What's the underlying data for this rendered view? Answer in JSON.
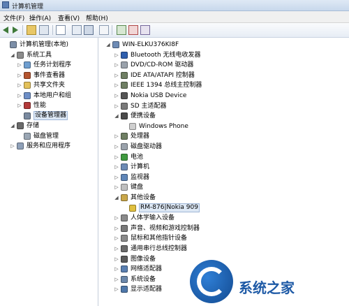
{
  "window": {
    "title": "计算机管理"
  },
  "menu": [
    "文件(F)",
    "操作(A)",
    "查看(V)",
    "帮助(H)"
  ],
  "toolbar_icons": [
    "back-arrow-icon",
    "forward-arrow-icon",
    "up-folder-icon",
    "show-tree-icon",
    "help-icon",
    "properties-icon",
    "refresh-icon",
    "export-icon",
    "update-driver-icon",
    "uninstall-icon",
    "disable-icon"
  ],
  "left_tree": [
    {
      "label": "计算机管理(本地)",
      "level": 0,
      "expand": "",
      "icon": "computer-management-icon"
    },
    {
      "label": "系统工具",
      "level": 1,
      "expand": "◢",
      "icon": "tools-icon"
    },
    {
      "label": "任务计划程序",
      "level": 2,
      "expand": "▷",
      "icon": "clock-icon"
    },
    {
      "label": "事件查看器",
      "level": 2,
      "expand": "▷",
      "icon": "event-viewer-icon"
    },
    {
      "label": "共享文件夹",
      "level": 2,
      "expand": "▷",
      "icon": "folder-icon"
    },
    {
      "label": "本地用户和组",
      "level": 2,
      "expand": "▷",
      "icon": "users-icon"
    },
    {
      "label": "性能",
      "level": 2,
      "expand": "▷",
      "icon": "performance-icon"
    },
    {
      "label": "设备管理器",
      "level": 2,
      "expand": "",
      "icon": "device-manager-icon"
    },
    {
      "label": "存储",
      "level": 1,
      "expand": "◢",
      "icon": "storage-icon"
    },
    {
      "label": "磁盘管理",
      "level": 2,
      "expand": "",
      "icon": "disk-icon"
    },
    {
      "label": "服务和应用程序",
      "level": 1,
      "expand": "▷",
      "icon": "services-icon"
    }
  ],
  "right_tree": [
    {
      "label": "WIN-ELKU376KI8F",
      "level": 0,
      "expand": "◢",
      "icon": "computer-icon"
    },
    {
      "label": "Bluetooth 无线电收发器",
      "level": 1,
      "expand": "▷",
      "icon": "bluetooth-icon"
    },
    {
      "label": "DVD/CD-ROM 驱动器",
      "level": 1,
      "expand": "▷",
      "icon": "dvd-icon"
    },
    {
      "label": "IDE ATA/ATAPI 控制器",
      "level": 1,
      "expand": "▷",
      "icon": "ide-icon"
    },
    {
      "label": "IEEE 1394 总线主控制器",
      "level": 1,
      "expand": "▷",
      "icon": "ieee1394-icon"
    },
    {
      "label": "Nokia USB Device",
      "level": 1,
      "expand": "▷",
      "icon": "usb-device-icon"
    },
    {
      "label": "SD 主适配器",
      "level": 1,
      "expand": "▷",
      "icon": "sd-icon"
    },
    {
      "label": "便携设备",
      "level": 1,
      "expand": "◢",
      "icon": "portable-device-icon"
    },
    {
      "label": "Windows Phone",
      "level": 2,
      "expand": "",
      "icon": "phone-icon"
    },
    {
      "label": "处理器",
      "level": 1,
      "expand": "▷",
      "icon": "processor-icon"
    },
    {
      "label": "磁盘驱动器",
      "level": 1,
      "expand": "▷",
      "icon": "disk-drive-icon"
    },
    {
      "label": "电池",
      "level": 1,
      "expand": "▷",
      "icon": "battery-icon"
    },
    {
      "label": "计算机",
      "level": 1,
      "expand": "▷",
      "icon": "computer-icon"
    },
    {
      "label": "监视器",
      "level": 1,
      "expand": "▷",
      "icon": "monitor-icon"
    },
    {
      "label": "键盘",
      "level": 1,
      "expand": "▷",
      "icon": "keyboard-icon"
    },
    {
      "label": "其他设备",
      "level": 1,
      "expand": "◢",
      "icon": "other-devices-icon"
    },
    {
      "label": "RM-876|Nokia 909",
      "level": 2,
      "expand": "",
      "icon": "warning-device-icon"
    },
    {
      "label": "人体学输入设备",
      "level": 1,
      "expand": "▷",
      "icon": "hid-icon"
    },
    {
      "label": "声音、视频和游戏控制器",
      "level": 1,
      "expand": "▷",
      "icon": "sound-icon"
    },
    {
      "label": "鼠标和其他指针设备",
      "level": 1,
      "expand": "▷",
      "icon": "mouse-icon"
    },
    {
      "label": "通用串行总线控制器",
      "level": 1,
      "expand": "▷",
      "icon": "usb-controller-icon"
    },
    {
      "label": "图像设备",
      "level": 1,
      "expand": "▷",
      "icon": "imaging-icon"
    },
    {
      "label": "网络适配器",
      "level": 1,
      "expand": "▷",
      "icon": "network-icon"
    },
    {
      "label": "系统设备",
      "level": 1,
      "expand": "▷",
      "icon": "system-device-icon"
    },
    {
      "label": "显示适配器",
      "level": 1,
      "expand": "▷",
      "icon": "display-adapter-icon"
    }
  ],
  "selected_left": "设备管理器",
  "selected_right": "RM-876|Nokia 909",
  "watermark": {
    "text": "系统之家"
  },
  "colors": {
    "selection": "#dde8f5",
    "toolbar": "#e7edf5",
    "watermark": "#1e5aa6"
  }
}
